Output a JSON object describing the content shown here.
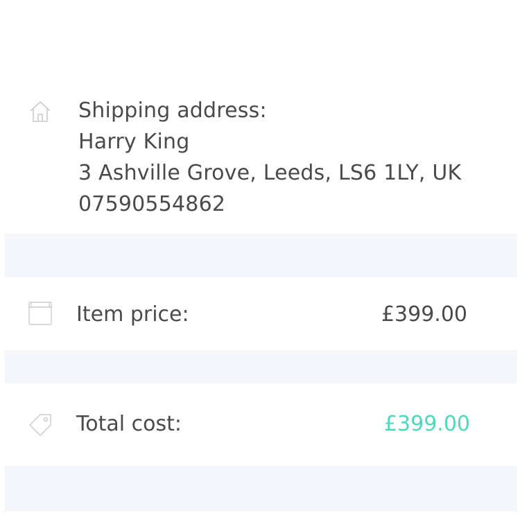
{
  "shipping": {
    "heading": "Shipping address:",
    "name": "Harry King",
    "address": "3 Ashville Grove, Leeds, LS6 1LY, UK",
    "phone": "07590554862",
    "icon": "home-icon"
  },
  "item": {
    "label": "Item price:",
    "value": "£399.00",
    "icon": "box-icon"
  },
  "total": {
    "label": "Total cost:",
    "value": "£399.00",
    "icon": "tag-icon",
    "value_color": "#4fd8b9"
  },
  "colors": {
    "text": "#4a4a4a",
    "icon": "#c8ccd2",
    "band": "#f5f6fb",
    "accent": "#4fd8b9"
  }
}
